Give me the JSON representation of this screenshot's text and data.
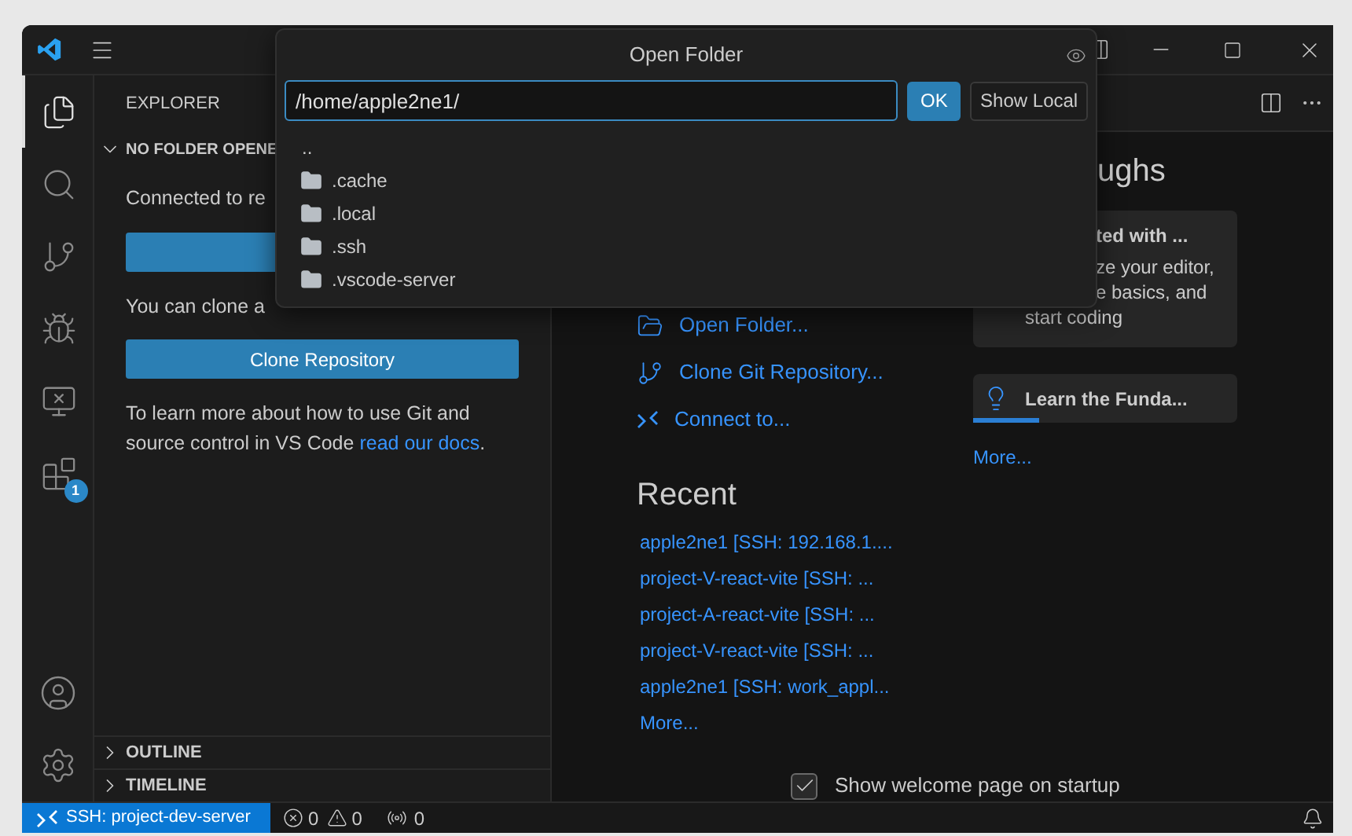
{
  "activity_bar": {
    "items": [
      {
        "kind": "explorer",
        "selected": true
      },
      {
        "kind": "search",
        "selected": false
      },
      {
        "kind": "source-control",
        "selected": false
      },
      {
        "kind": "run-debug",
        "selected": false
      },
      {
        "kind": "remote",
        "selected": false
      },
      {
        "kind": "extensions",
        "selected": false,
        "badge": "1"
      }
    ],
    "bottom": [
      {
        "kind": "account"
      },
      {
        "kind": "settings"
      }
    ]
  },
  "sidebar": {
    "title": "EXPLORER",
    "section": {
      "title": "NO FOLDER OPENE",
      "expanded": true
    },
    "text_1": "Connected to re",
    "text_2": "You can clone a",
    "clone_button": "Clone Repository",
    "help": {
      "text": "To learn more about how to use Git and source control in VS Code ",
      "link": "read our docs",
      "end": "."
    },
    "panels": [
      {
        "title": "OUTLINE",
        "expanded": false
      },
      {
        "title": "TIMELINE",
        "expanded": false
      }
    ]
  },
  "welcome": {
    "start": [
      {
        "kind": "open-folder",
        "label": "Open Folder..."
      },
      {
        "kind": "clone",
        "label": "Clone Git Repository..."
      },
      {
        "kind": "connect",
        "label": "Connect to..."
      }
    ],
    "recent_title": "Recent",
    "recent": [
      "apple2ne1 [SSH: 192.168.1....",
      "project-V-react-vite [SSH: ...",
      "project-A-react-vite [SSH: ...",
      "project-V-react-vite [SSH: ...",
      "apple2ne1 [SSH: work_appl..."
    ],
    "recent_more": "More...",
    "walkthroughs_title": "ughs",
    "walkthroughs": [
      {
        "kind": "featured",
        "title": "ted with ...",
        "lines": [
          "ze your editor,",
          "e basics, and",
          "start coding"
        ]
      },
      {
        "kind": "item",
        "title": "Learn the Funda...",
        "level": 0.25
      }
    ],
    "walkthroughs_more": "More...",
    "show_on_startup": {
      "label": "Show welcome page on startup",
      "checked": true
    }
  },
  "status_bar": {
    "remote": "SSH: project-dev-server",
    "errors": "0",
    "warnings": "0",
    "ports": "0"
  },
  "dialog": {
    "title": "Open Folder",
    "input": {
      "value": "/home/apple2ne1/"
    },
    "ok": "OK",
    "show_local": "Show Local",
    "items": [
      {
        "kind": "parent",
        "label": ".."
      },
      {
        "kind": "folder",
        "label": ".cache"
      },
      {
        "kind": "folder",
        "label": ".local"
      },
      {
        "kind": "folder",
        "label": ".ssh"
      },
      {
        "kind": "folder",
        "label": ".vscode-server"
      }
    ]
  }
}
